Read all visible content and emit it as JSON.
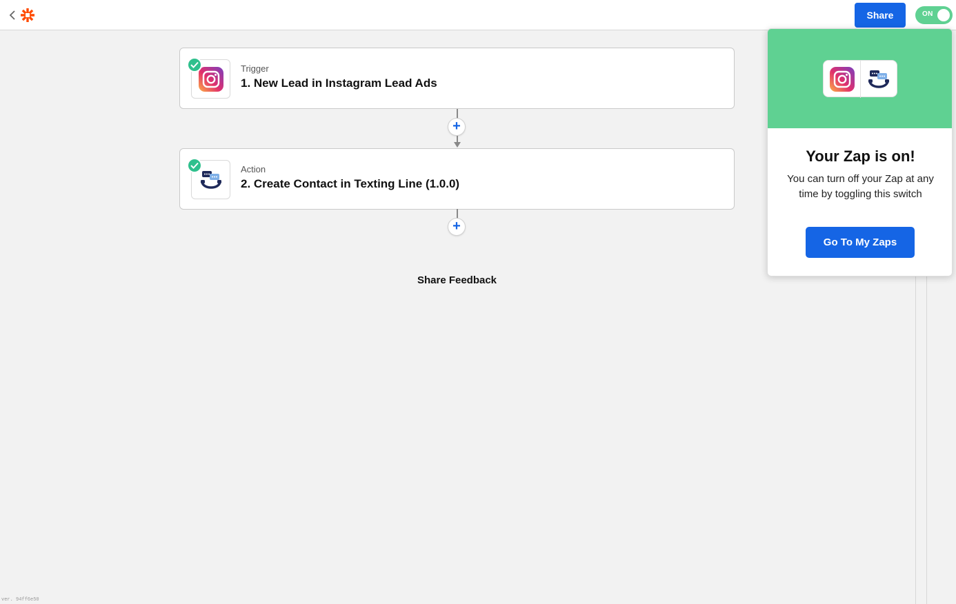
{
  "header": {
    "share_label": "Share",
    "toggle_label": "ON",
    "back_icon": "chevron-left-icon",
    "logo_icon": "zapier-logo-icon",
    "brand_color": "#ff4a00",
    "accent_color": "#1565e5"
  },
  "steps": [
    {
      "type": "Trigger",
      "title": "1. New Lead in Instagram Lead Ads",
      "icon": "instagram-icon",
      "status": "complete"
    },
    {
      "type": "Action",
      "title": "2. Create Contact in Texting Line (1.0.0)",
      "icon": "texting-line-icon",
      "status": "complete"
    }
  ],
  "feedback_label": "Share Feedback",
  "version_text": "ver. 94ff6e50",
  "popover": {
    "title": "Your Zap is on!",
    "body": "You can turn off your Zap at any time by toggling this switch",
    "button_label": "Go To My Zaps",
    "hero_color": "#5fd192"
  }
}
